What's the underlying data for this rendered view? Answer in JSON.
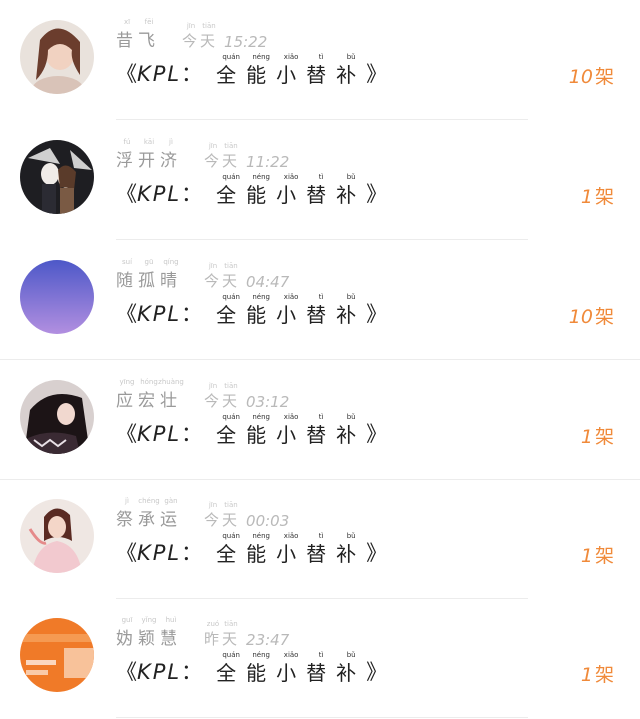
{
  "rows": [
    {
      "name": [
        {
          "c": "昔",
          "p": "xī"
        },
        {
          "c": "飞",
          "p": "fēi"
        }
      ],
      "day": [
        {
          "c": "今",
          "p": "jīn"
        },
        {
          "c": "天",
          "p": "tiān"
        }
      ],
      "time": "15:22",
      "count": "10",
      "unit": "架",
      "avatar": "photo-woman"
    },
    {
      "name": [
        {
          "c": "浮",
          "p": "fú"
        },
        {
          "c": "开",
          "p": "kāi"
        },
        {
          "c": "济",
          "p": "jì"
        }
      ],
      "day": [
        {
          "c": "今",
          "p": "jīn"
        },
        {
          "c": "天",
          "p": "tiān"
        }
      ],
      "time": "11:22",
      "count": "1",
      "unit": "架",
      "avatar": "anime-couple"
    },
    {
      "name": [
        {
          "c": "随",
          "p": "suí"
        },
        {
          "c": "孤",
          "p": "gū"
        },
        {
          "c": "晴",
          "p": "qíng"
        }
      ],
      "day": [
        {
          "c": "今",
          "p": "jīn"
        },
        {
          "c": "天",
          "p": "tiān"
        }
      ],
      "time": "04:47",
      "count": "10",
      "unit": "架",
      "avatar": "gradient-circle"
    },
    {
      "name": [
        {
          "c": "应",
          "p": "yīng"
        },
        {
          "c": "宏",
          "p": "hóng"
        },
        {
          "c": "壮",
          "p": "zhuàng"
        }
      ],
      "day": [
        {
          "c": "今",
          "p": "jīn"
        },
        {
          "c": "天",
          "p": "tiān"
        }
      ],
      "time": "03:12",
      "count": "1",
      "unit": "架",
      "avatar": "dark-portrait"
    },
    {
      "name": [
        {
          "c": "祭",
          "p": "jì"
        },
        {
          "c": "承",
          "p": "chéng"
        },
        {
          "c": "运",
          "p": "gàn"
        }
      ],
      "day": [
        {
          "c": "今",
          "p": "jīn"
        },
        {
          "c": "天",
          "p": "tiān"
        }
      ],
      "time": "00:03",
      "count": "1",
      "unit": "架",
      "avatar": "photo-girl"
    },
    {
      "name": [
        {
          "c": "妫",
          "p": "guī"
        },
        {
          "c": "颖",
          "p": "yǐng"
        },
        {
          "c": "慧",
          "p": "huì"
        }
      ],
      "day": [
        {
          "c": "昨",
          "p": "zuó"
        },
        {
          "c": "天",
          "p": "tiān"
        }
      ],
      "time": "23:47",
      "count": "1",
      "unit": "架",
      "avatar": "orange-ad"
    }
  ],
  "title": {
    "open": "《",
    "prefix": "KPL",
    "colon": "：",
    "words": [
      {
        "c": "全",
        "p": "quán"
      },
      {
        "c": "能",
        "p": "néng"
      },
      {
        "c": "小",
        "p": "xiǎo"
      },
      {
        "c": "替",
        "p": "tì"
      },
      {
        "c": "补",
        "p": "bǔ"
      }
    ],
    "close": "》"
  },
  "colors": {
    "accent": "#f08a3a",
    "name": "#9a9a9a",
    "divider": "#ececec"
  }
}
